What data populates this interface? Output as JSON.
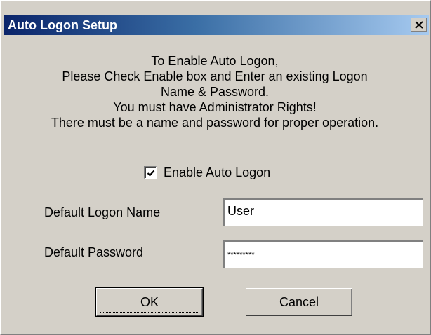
{
  "window": {
    "title": "Auto Logon Setup"
  },
  "instructions": [
    "To Enable Auto Logon,",
    "Please Check Enable box and Enter an existing Logon",
    "Name & Password.",
    "You must have Administrator Rights!",
    "There must be a name and password for proper operation."
  ],
  "enable_auto_logon": {
    "label": "Enable Auto Logon",
    "checked": true
  },
  "logon_name": {
    "label": "Default Logon Name",
    "value": "User"
  },
  "password": {
    "label": "Default Password",
    "value": "*********"
  },
  "buttons": {
    "ok": "OK",
    "cancel": "Cancel"
  },
  "colors": {
    "titlebar_start": "#0a246a",
    "titlebar_end": "#a6caf0",
    "dialog_face": "#d4d0c8"
  },
  "icons": {
    "close": "close-icon",
    "check": "checkmark-icon"
  }
}
